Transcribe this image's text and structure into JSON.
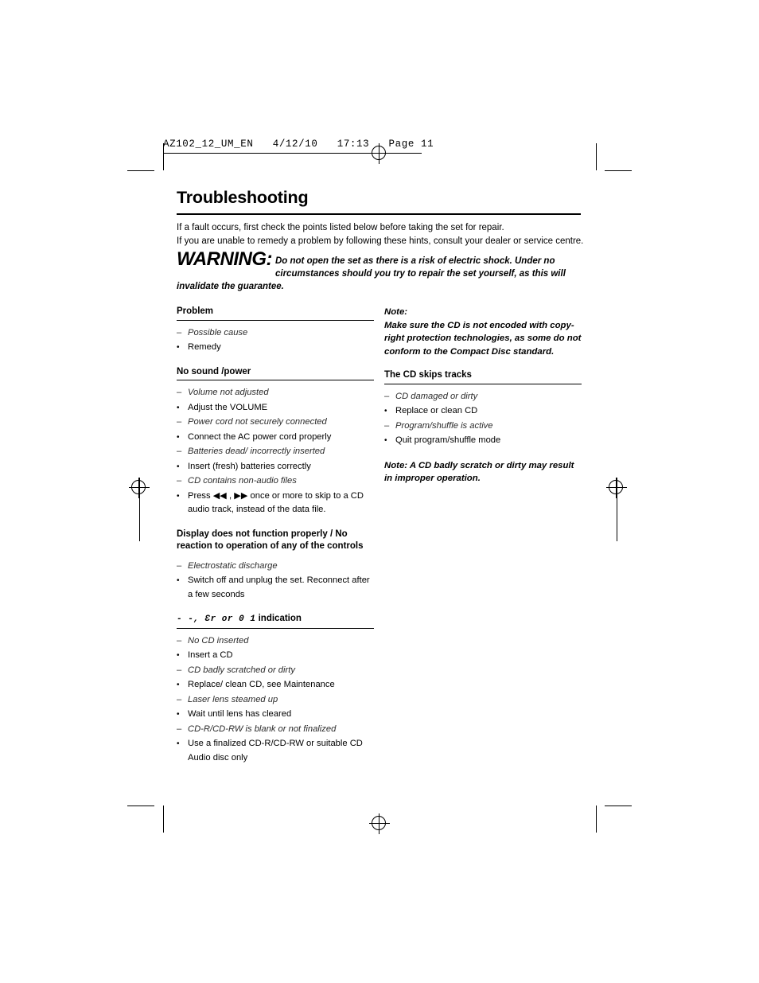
{
  "print_header": {
    "text": "AZ102_12_UM_EN   4/12/10   17:13   Page 11"
  },
  "document": {
    "title": "Troubleshooting",
    "intro_line1": "If a fault occurs, first check the points listed below before taking the set for repair.",
    "intro_line2": "If you are unable to remedy a problem by following these hints, consult your dealer or service centre.",
    "warning_word": "WARNING:",
    "warning_text": "Do not open the set as there is a risk of electric shock. Under no circumstances should you try to repair the set yourself, as this will invalidate the guarantee."
  },
  "left_column": {
    "sections": [
      {
        "heading": "Problem",
        "items": [
          {
            "type": "cause",
            "mark": "–",
            "text": "Possible cause"
          },
          {
            "type": "remedy",
            "mark": "•",
            "text": "Remedy"
          }
        ]
      },
      {
        "heading": "No sound /power",
        "items": [
          {
            "type": "cause",
            "mark": "–",
            "text": "Volume not adjusted"
          },
          {
            "type": "remedy",
            "mark": "•",
            "text": "Adjust the VOLUME"
          },
          {
            "type": "cause",
            "mark": "–",
            "text": "Power cord not securely connected"
          },
          {
            "type": "remedy",
            "mark": "•",
            "text": "Connect the AC power cord properly"
          },
          {
            "type": "cause",
            "mark": "–",
            "text": "Batteries dead/ incorrectly inserted"
          },
          {
            "type": "remedy",
            "mark": "•",
            "text": "Insert (fresh) batteries correctly"
          },
          {
            "type": "cause",
            "mark": "–",
            "text": "CD contains non-audio files"
          },
          {
            "type": "remedy",
            "mark": "•",
            "text": "Press ◀◀ , ▶▶ once or more to skip to a CD audio track, instead of the data file."
          }
        ]
      },
      {
        "heading": "Display does not function properly / No reaction to operation of any of the controls",
        "items": [
          {
            "type": "cause",
            "mark": "–",
            "text": "Electrostatic discharge"
          },
          {
            "type": "remedy",
            "mark": "•",
            "text": "Switch off and unplug the set. Reconnect after a few seconds"
          }
        ]
      },
      {
        "heading_lcd": "- -, Ɛr  or  0 1",
        "heading_suffix": " indication",
        "items": [
          {
            "type": "cause",
            "mark": "–",
            "text": "No CD inserted"
          },
          {
            "type": "remedy",
            "mark": "•",
            "text": "Insert a CD"
          },
          {
            "type": "cause",
            "mark": "–",
            "text": "CD badly scratched or dirty"
          },
          {
            "type": "remedy",
            "mark": "•",
            "text": "Replace/ clean CD, see Maintenance"
          },
          {
            "type": "cause",
            "mark": "–",
            "text": "Laser lens steamed up"
          },
          {
            "type": "remedy",
            "mark": "•",
            "text": "Wait until lens has cleared"
          },
          {
            "type": "cause",
            "mark": "–",
            "text": "CD-R/CD-RW is blank or not finalized"
          },
          {
            "type": "remedy",
            "mark": "•",
            "text": "Use a finalized CD-R/CD-RW or suitable CD Audio disc only"
          }
        ]
      }
    ]
  },
  "right_column": {
    "note_label": "Note:",
    "note_text": "Make sure the CD is not encoded with copy-right protection technologies, as some do not conform to the Compact Disc standard.",
    "section": {
      "heading": "The CD skips tracks",
      "items": [
        {
          "type": "cause",
          "mark": "–",
          "text": "CD damaged or dirty"
        },
        {
          "type": "remedy",
          "mark": "•",
          "text": "Replace or clean CD"
        },
        {
          "type": "cause",
          "mark": "–",
          "text": "Program/shuffle is active"
        },
        {
          "type": "remedy",
          "mark": "•",
          "text": "Quit program/shuffle mode"
        }
      ]
    },
    "note2": "Note: A CD badly scratch or dirty may result in improper operation."
  }
}
